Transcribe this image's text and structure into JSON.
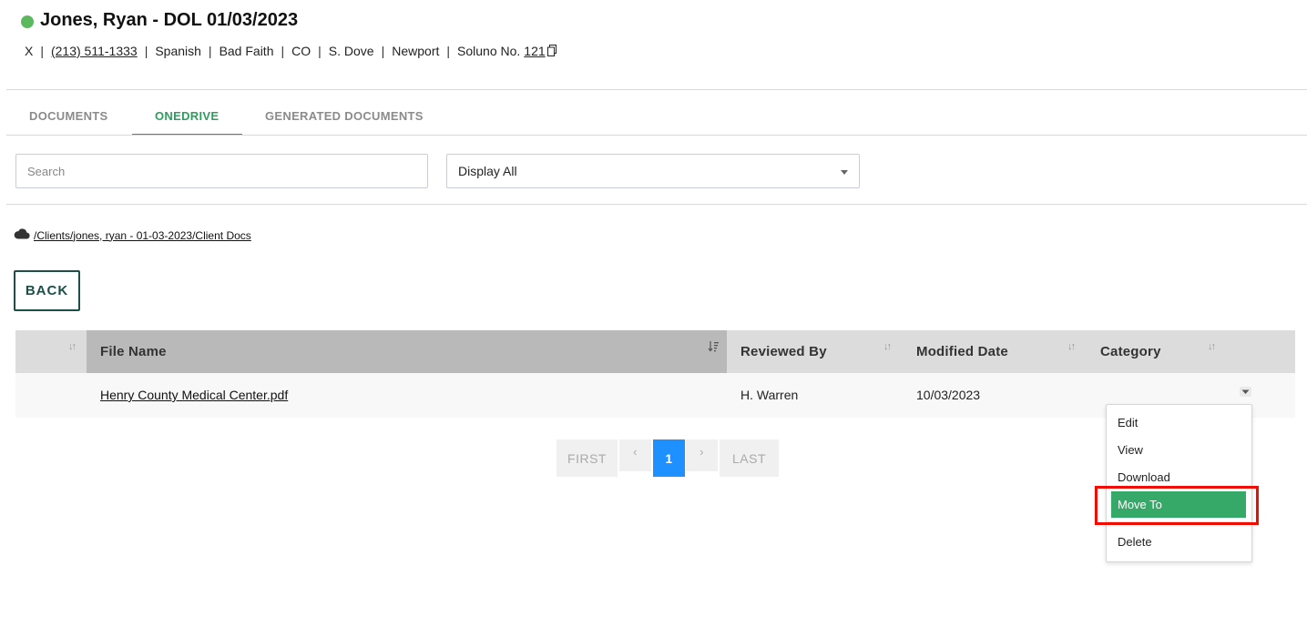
{
  "header": {
    "title": "Jones, Ryan - DOL 01/03/2023",
    "status_color": "#5cb85c",
    "meta": {
      "x": "X",
      "phone": "(213) 511-1333",
      "language": "Spanish",
      "case_type": "Bad Faith",
      "state": "CO",
      "attorney": "S. Dove",
      "office": "Newport",
      "soluno_label": "Soluno No.",
      "soluno_number": "121",
      "separator": "|"
    }
  },
  "tabs": [
    {
      "label": "DOCUMENTS",
      "active": false
    },
    {
      "label": "ONEDRIVE",
      "active": true
    },
    {
      "label": "GENERATED DOCUMENTS",
      "active": false
    }
  ],
  "filters": {
    "search_placeholder": "Search",
    "display_select": "Display All"
  },
  "breadcrumb": {
    "icon": "cloud-icon",
    "path": "/Clients/jones, ryan - 01-03-2023/Client Docs"
  },
  "back_label": "BACK",
  "table": {
    "columns": [
      "",
      "File Name",
      "Reviewed By",
      "Modified Date",
      "Category"
    ],
    "rows": [
      {
        "file_name": "Henry County Medical Center.pdf",
        "reviewed_by": "H. Warren",
        "modified_date": "10/03/2023",
        "category": ""
      }
    ]
  },
  "pagination": {
    "first": "FIRST",
    "prev": "‹",
    "current": "1",
    "next": "›",
    "last": "LAST"
  },
  "row_menu": {
    "items": [
      "Edit",
      "View",
      "Download",
      "Move To",
      "Delete"
    ],
    "highlighted": "Move To",
    "highlight_color": "#36a868",
    "annotation_color": "#f20c00"
  },
  "colors": {
    "accent_green": "#2e9e5e",
    "back_button": "#1d4f47",
    "page_active": "#1e90ff"
  }
}
